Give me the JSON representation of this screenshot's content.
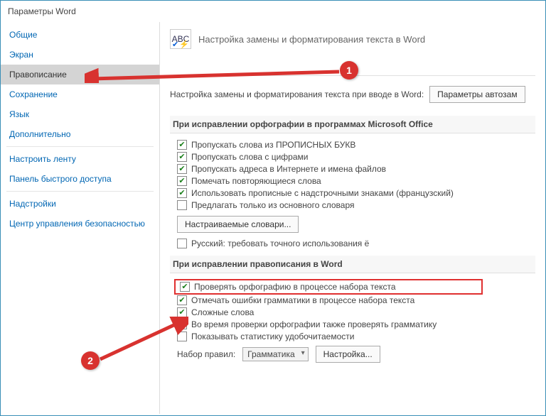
{
  "title": "Параметры Word",
  "sidebar": {
    "items": [
      {
        "label": "Общие"
      },
      {
        "label": "Экран"
      },
      {
        "label": "Правописание"
      },
      {
        "label": "Сохранение"
      },
      {
        "label": "Язык"
      },
      {
        "label": "Дополнительно"
      },
      {
        "label": "Настроить ленту"
      },
      {
        "label": "Панель быстрого доступа"
      },
      {
        "label": "Надстройки"
      },
      {
        "label": "Центр управления безопасностью"
      }
    ]
  },
  "header": {
    "icon_text": "ABC",
    "title": "Настройка замены и форматирования текста в Word"
  },
  "autocorrect": {
    "label": "Настройка замены и форматирования текста при вводе в Word:",
    "button": "Параметры автозам"
  },
  "section_office": {
    "title": "При исправлении орфографии в программах Microsoft Office",
    "opts": [
      {
        "label": "Пропускать слова из ПРОПИСНЫХ БУКВ",
        "checked": true
      },
      {
        "label": "Пропускать слова с цифрами",
        "checked": true
      },
      {
        "label": "Пропускать адреса в Интернете и имена файлов",
        "checked": true
      },
      {
        "label": "Помечать повторяющиеся слова",
        "checked": true
      },
      {
        "label": "Использовать прописные с надстрочными знаками (французский)",
        "checked": true
      },
      {
        "label": "Предлагать только из основного словаря",
        "checked": false
      }
    ],
    "dict_button": "Настраиваемые словари...",
    "russian": {
      "label": "Русский: требовать точного использования ё",
      "checked": false
    }
  },
  "section_word": {
    "title": "При исправлении правописания в Word",
    "opts": [
      {
        "label": "Проверять орфографию в процессе набора текста",
        "checked": true
      },
      {
        "label": "Отмечать ошибки грамматики в процессе набора текста",
        "checked": true
      },
      {
        "label": "Сложные слова",
        "checked": true
      },
      {
        "label": "Во время проверки орфографии также проверять грамматику",
        "checked": true
      },
      {
        "label": "Показывать статистику удобочитаемости",
        "checked": false
      }
    ],
    "rules_label": "Набор правил:",
    "rules_value": "Грамматика",
    "settings_button": "Настройка..."
  },
  "badges": {
    "one": "1",
    "two": "2"
  }
}
